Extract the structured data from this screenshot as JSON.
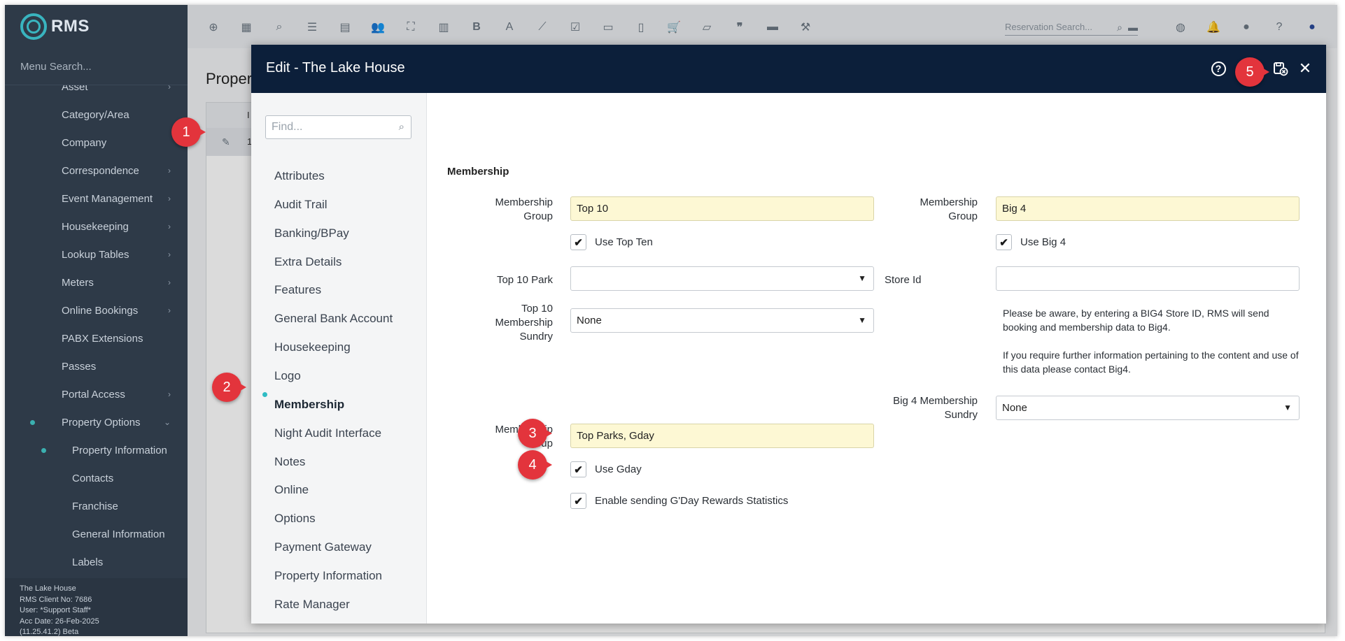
{
  "app": {
    "logo_text": "RMS",
    "menu_search_placeholder": "Menu Search...",
    "sidebar_items": [
      {
        "label": "Asset",
        "chevron": true
      },
      {
        "label": "Category/Area",
        "chevron": false
      },
      {
        "label": "Company",
        "chevron": false
      },
      {
        "label": "Correspondence",
        "chevron": true
      },
      {
        "label": "Event Management",
        "chevron": true
      },
      {
        "label": "Housekeeping",
        "chevron": true
      },
      {
        "label": "Lookup Tables",
        "chevron": true
      },
      {
        "label": "Meters",
        "chevron": true
      },
      {
        "label": "Online Bookings",
        "chevron": true
      },
      {
        "label": "PABX Extensions",
        "chevron": false
      },
      {
        "label": "Passes",
        "chevron": false
      },
      {
        "label": "Portal Access",
        "chevron": true
      },
      {
        "label": "Property Options",
        "chevron": true
      },
      {
        "label": "Property Information",
        "chevron": false
      },
      {
        "label": "Contacts",
        "chevron": false
      },
      {
        "label": "Franchise",
        "chevron": false
      },
      {
        "label": "General Information",
        "chevron": false
      },
      {
        "label": "Labels",
        "chevron": false
      }
    ],
    "footer": {
      "property": "The Lake House",
      "client": "RMS Client No: 7686",
      "user": "User: *Support Staff*",
      "acc_date": "Acc Date: 26-Feb-2025",
      "version": "(11.25.41.2) Beta"
    },
    "reservation_search_placeholder": "Reservation Search...",
    "page_title": "Proper",
    "bg_col_header": "I",
    "bg_row_value": "1"
  },
  "modal": {
    "title": "Edit - The Lake House",
    "find_placeholder": "Find...",
    "nav_items": [
      "Attributes",
      "Audit Trail",
      "Banking/BPay",
      "Extra Details",
      "Features",
      "General Bank Account",
      "Housekeeping",
      "Logo",
      "Membership",
      "Night Audit Interface",
      "Notes",
      "Online",
      "Options",
      "Payment Gateway",
      "Property Information",
      "Rate Manager"
    ],
    "active_nav": "Membership",
    "section_title": "Membership",
    "left": {
      "group_label": "Membership Group",
      "group_value": "Top 10",
      "use_label": "Use Top Ten",
      "park_label": "Top 10 Park",
      "park_value": "",
      "sundry_label": "Top 10 Membership Sundry",
      "sundry_value": "None",
      "group2_label": "Membership Group",
      "group2_value": "Top Parks, Gday",
      "use_gday_label": "Use Gday",
      "rewards_label": "Enable sending G'Day Rewards Statistics"
    },
    "right": {
      "group_label": "Membership Group",
      "group_value": "Big 4",
      "use_label": "Use Big 4",
      "store_label": "Store Id",
      "store_value": "",
      "note1": "Please be aware, by entering a BIG4 Store ID, RMS will send booking and membership data to Big4.",
      "note2": "If you require further information pertaining to the content and use of this data please contact Big4.",
      "sundry_label": "Big 4 Membership Sundry",
      "sundry_value": "None"
    }
  },
  "callouts": [
    "1",
    "2",
    "3",
    "4",
    "5"
  ],
  "colors": {
    "sidebar": "#2e3a48",
    "modal_header": "#0c1f3a",
    "accent": "#2fbcc4",
    "callout": "#e3343c",
    "highlight_field": "#fdf8d4"
  }
}
